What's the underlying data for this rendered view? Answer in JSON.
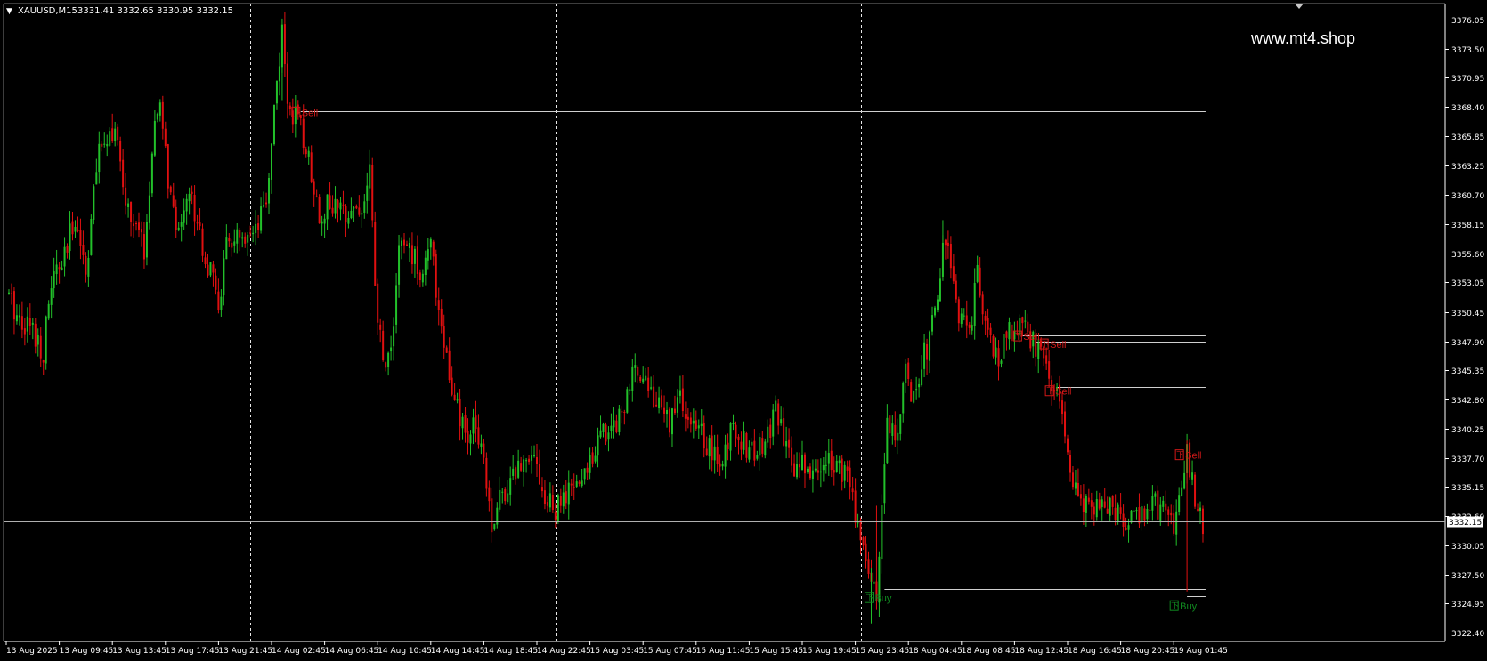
{
  "header": {
    "symbol_label": "XAUUSD,M15",
    "ohlc": "3331.41 3332.65 3330.95 3332.15",
    "menu_glyph": "▼"
  },
  "watermark": "www.mt4.shop",
  "colors": {
    "background": "#000000",
    "bull": "#22c02a",
    "bear": "#e01010",
    "grid": "#ffffff",
    "level_line": "#d0d0d0",
    "signal_sell": "#d01818",
    "signal_buy": "#108a20",
    "axis_text": "#ffffff",
    "price_tag_bg": "#ffffff",
    "price_tag_text": "#000000"
  },
  "chart_data": {
    "type": "candlestick",
    "symbol": "XAUUSD",
    "timeframe": "M15",
    "y_range": [
      3322.4,
      3377.0
    ],
    "x_range_bars": [
      0,
      566
    ],
    "y_ticks": [
      "3376.05",
      "3373.50",
      "3370.95",
      "3368.40",
      "3365.85",
      "3363.25",
      "3360.70",
      "3358.15",
      "3355.60",
      "3353.05",
      "3350.45",
      "3347.90",
      "3345.35",
      "3342.80",
      "3340.25",
      "3337.70",
      "3335.15",
      "3332.60",
      "3330.05",
      "3327.50",
      "3324.95",
      "3322.40"
    ],
    "x_ticks": [
      {
        "label": "13 Aug 2025",
        "bar": 0
      },
      {
        "label": "13 Aug 09:45",
        "bar": 20
      },
      {
        "label": "13 Aug 13:45",
        "bar": 40
      },
      {
        "label": "13 Aug 17:45",
        "bar": 60
      },
      {
        "label": "13 Aug 21:45",
        "bar": 80
      },
      {
        "label": "14 Aug 02:45",
        "bar": 100
      },
      {
        "label": "14 Aug 06:45",
        "bar": 120
      },
      {
        "label": "14 Aug 10:45",
        "bar": 140
      },
      {
        "label": "14 Aug 14:45",
        "bar": 160
      },
      {
        "label": "14 Aug 18:45",
        "bar": 180
      },
      {
        "label": "14 Aug 22:45",
        "bar": 200
      },
      {
        "label": "15 Aug 03:45",
        "bar": 220
      },
      {
        "label": "15 Aug 07:45",
        "bar": 240
      },
      {
        "label": "15 Aug 11:45",
        "bar": 260
      },
      {
        "label": "15 Aug 15:45",
        "bar": 280
      },
      {
        "label": "15 Aug 19:45",
        "bar": 300
      },
      {
        "label": "15 Aug 23:45",
        "bar": 320
      },
      {
        "label": "18 Aug 04:45",
        "bar": 340
      },
      {
        "label": "18 Aug 08:45",
        "bar": 360
      },
      {
        "label": "18 Aug 12:45",
        "bar": 380
      },
      {
        "label": "18 Aug 16:45",
        "bar": 400
      },
      {
        "label": "18 Aug 20:45",
        "bar": 420
      },
      {
        "label": "19 Aug 01:45",
        "bar": 440
      }
    ],
    "day_separators_bar": [
      92,
      207,
      322,
      437
    ],
    "current_price": 3332.15,
    "current_price_label": "3332.15",
    "price_path": [
      [
        0,
        3352.0
      ],
      [
        5,
        3350.0
      ],
      [
        10,
        3349.0
      ],
      [
        14,
        3347.0
      ],
      [
        17,
        3353.0
      ],
      [
        22,
        3355.0
      ],
      [
        26,
        3359.0
      ],
      [
        30,
        3354.0
      ],
      [
        34,
        3363.0
      ],
      [
        37,
        3366.0
      ],
      [
        41,
        3366.5
      ],
      [
        44,
        3361.0
      ],
      [
        48,
        3358.0
      ],
      [
        52,
        3356.0
      ],
      [
        56,
        3366.0
      ],
      [
        58,
        3369.0
      ],
      [
        61,
        3362.0
      ],
      [
        64,
        3357.0
      ],
      [
        68,
        3361.0
      ],
      [
        72,
        3359.0
      ],
      [
        75,
        3355.0
      ],
      [
        78,
        3353.0
      ],
      [
        80,
        3351.0
      ],
      [
        83,
        3356.0
      ],
      [
        86,
        3357.0
      ],
      [
        90,
        3356.0
      ],
      [
        94,
        3357.0
      ],
      [
        98,
        3360.0
      ],
      [
        102,
        3371.0
      ],
      [
        104,
        3374.5
      ],
      [
        106,
        3369.0
      ],
      [
        110,
        3367.0
      ],
      [
        114,
        3364.0
      ],
      [
        118,
        3359.0
      ],
      [
        122,
        3360.0
      ],
      [
        126,
        3359.0
      ],
      [
        130,
        3360.0
      ],
      [
        134,
        3359.0
      ],
      [
        137,
        3363.0
      ],
      [
        139,
        3352.0
      ],
      [
        142,
        3346.0
      ],
      [
        145,
        3347.0
      ],
      [
        148,
        3356.0
      ],
      [
        152,
        3356.0
      ],
      [
        156,
        3354.0
      ],
      [
        160,
        3356.0
      ],
      [
        163,
        3351.0
      ],
      [
        165,
        3348.0
      ],
      [
        168,
        3343.0
      ],
      [
        171,
        3341.0
      ],
      [
        174,
        3339.0
      ],
      [
        177,
        3341.0
      ],
      [
        180,
        3338.0
      ],
      [
        183,
        3332.0
      ],
      [
        186,
        3334.0
      ],
      [
        190,
        3336.0
      ],
      [
        194,
        3337.0
      ],
      [
        198,
        3339.0
      ],
      [
        201,
        3336.0
      ],
      [
        203,
        3334.0
      ],
      [
        207,
        3333.0
      ],
      [
        210,
        3334.0
      ],
      [
        214,
        3335.0
      ],
      [
        218,
        3336.0
      ],
      [
        222,
        3339.0
      ],
      [
        226,
        3340.0
      ],
      [
        230,
        3341.0
      ],
      [
        234,
        3343.0
      ],
      [
        238,
        3346.0
      ],
      [
        242,
        3344.0
      ],
      [
        246,
        3342.0
      ],
      [
        250,
        3341.0
      ],
      [
        254,
        3343.0
      ],
      [
        258,
        3340.0
      ],
      [
        262,
        3340.0
      ],
      [
        266,
        3338.0
      ],
      [
        270,
        3337.0
      ],
      [
        274,
        3341.0
      ],
      [
        278,
        3339.0
      ],
      [
        282,
        3338.0
      ],
      [
        286,
        3339.0
      ],
      [
        290,
        3342.0
      ],
      [
        294,
        3338.0
      ],
      [
        298,
        3337.0
      ],
      [
        302,
        3337.0
      ],
      [
        306,
        3336.0
      ],
      [
        310,
        3338.0
      ],
      [
        314,
        3337.0
      ],
      [
        318,
        3335.0
      ],
      [
        320,
        3333.0
      ],
      [
        322,
        3331.0
      ],
      [
        326,
        3327.0
      ],
      [
        328,
        3325.5
      ],
      [
        330,
        3334.0
      ],
      [
        332,
        3341.0
      ],
      [
        336,
        3340.0
      ],
      [
        339,
        3345.0
      ],
      [
        342,
        3343.0
      ],
      [
        345,
        3346.0
      ],
      [
        348,
        3348.0
      ],
      [
        351,
        3351.0
      ],
      [
        353,
        3357.0
      ],
      [
        355,
        3356.0
      ],
      [
        357,
        3352.0
      ],
      [
        360,
        3350.0
      ],
      [
        363,
        3348.0
      ],
      [
        366,
        3354.0
      ],
      [
        369,
        3350.0
      ],
      [
        372,
        3346.0
      ],
      [
        375,
        3347.0
      ],
      [
        378,
        3349.0
      ],
      [
        382,
        3349.0
      ],
      [
        386,
        3348.0
      ],
      [
        389,
        3347.0
      ],
      [
        392,
        3346.0
      ],
      [
        395,
        3344.0
      ],
      [
        398,
        3341.0
      ],
      [
        401,
        3336.0
      ],
      [
        404,
        3334.0
      ],
      [
        408,
        3333.0
      ],
      [
        412,
        3333.0
      ],
      [
        416,
        3334.0
      ],
      [
        420,
        3332.0
      ],
      [
        424,
        3332.0
      ],
      [
        428,
        3333.0
      ],
      [
        432,
        3334.0
      ],
      [
        436,
        3333.0
      ],
      [
        440,
        3332.0
      ],
      [
        442,
        3334.0
      ],
      [
        445,
        3338.0
      ],
      [
        448,
        3334.0
      ],
      [
        451,
        3332.0
      ]
    ],
    "levels": [
      {
        "price": 3368.0,
        "bar_from": 111,
        "bar_to": 452
      },
      {
        "price": 3348.4,
        "bar_from": 383,
        "bar_to": 452
      },
      {
        "price": 3347.9,
        "bar_from": 388,
        "bar_to": 452
      },
      {
        "price": 3343.9,
        "bar_from": 396,
        "bar_to": 452
      },
      {
        "price": 3326.2,
        "bar_from": 331,
        "bar_to": 452
      },
      {
        "price": 3325.6,
        "bar_from": 445,
        "bar_to": 452
      }
    ],
    "signals": [
      {
        "type": "sell",
        "label": "Sell",
        "glyph": "下",
        "bar": 110,
        "price": 3368.0
      },
      {
        "type": "sell",
        "label": "Sell",
        "glyph": "下",
        "bar": 382,
        "price": 3348.4
      },
      {
        "type": "sell",
        "label": "Sell",
        "glyph": "下",
        "bar": 392,
        "price": 3347.7
      },
      {
        "type": "sell",
        "label": "Sell",
        "glyph": "下",
        "bar": 394,
        "price": 3343.6
      },
      {
        "type": "sell",
        "label": "Sell",
        "glyph": "下",
        "bar": 443,
        "price": 3338.0
      },
      {
        "type": "buy",
        "label": "Buy",
        "glyph": "下",
        "bar": 326,
        "price": 3325.5
      },
      {
        "type": "buy",
        "label": "Buy",
        "glyph": "下",
        "bar": 441,
        "price": 3324.8
      }
    ]
  }
}
